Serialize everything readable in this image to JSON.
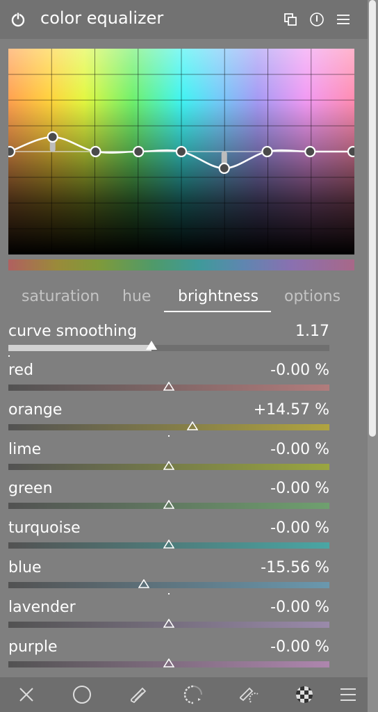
{
  "module": {
    "title": "color equalizer",
    "header_icons": [
      "power-icon",
      "presets-icon",
      "info-icon",
      "menu-icon"
    ]
  },
  "graph": {
    "hue_nodes": 9,
    "curve_values": [
      0.0,
      0.14,
      0.0,
      0.0,
      0.0,
      -0.16,
      0.0,
      0.0,
      0.0
    ],
    "colors": {
      "background_top": [
        "#ffa04f",
        "#ffd23c",
        "#e3f740",
        "#6ff06c",
        "#3ff4f2",
        "#6fcdf8",
        "#a49af4",
        "#f19af3",
        "#ff8cb0"
      ],
      "curve": "#ffffff",
      "node_fill": "#4a4a4a"
    }
  },
  "tabs": [
    {
      "label": "saturation",
      "active": false
    },
    {
      "label": "hue",
      "active": false
    },
    {
      "label": "brightness",
      "active": true
    },
    {
      "label": "options",
      "active": false
    }
  ],
  "curve_smoothing": {
    "label": "curve smoothing",
    "value": "1.17",
    "fill_fraction": 0.446
  },
  "sliders": [
    {
      "label": "red",
      "value": "-0.00 %",
      "position": 0.5,
      "colors": [
        "#525252",
        "#b17c7c"
      ]
    },
    {
      "label": "orange",
      "value": "+14.57 %",
      "position": 0.573,
      "colors": [
        "#525252",
        "#b0a440"
      ]
    },
    {
      "label": "lime",
      "value": "-0.00 %",
      "position": 0.5,
      "colors": [
        "#525252",
        "#9aa640"
      ]
    },
    {
      "label": "green",
      "value": "-0.00 %",
      "position": 0.5,
      "colors": [
        "#525252",
        "#6fa06f"
      ]
    },
    {
      "label": "turquoise",
      "value": "-0.00 %",
      "position": 0.5,
      "colors": [
        "#525252",
        "#4aa6a4"
      ]
    },
    {
      "label": "blue",
      "value": "-15.56 %",
      "position": 0.422,
      "colors": [
        "#525252",
        "#6a98ae"
      ]
    },
    {
      "label": "lavender",
      "value": "-0.00 %",
      "position": 0.5,
      "colors": [
        "#525252",
        "#9a8aaa"
      ]
    },
    {
      "label": "purple",
      "value": "-0.00 %",
      "position": 0.5,
      "colors": [
        "#525252",
        "#ae86ae"
      ]
    }
  ],
  "bottom_toolbar": [
    "close-icon",
    "circle-icon",
    "pencil-icon",
    "drawn-mask-icon",
    "parametric-mask-icon",
    "raster-mask-icon",
    "menu-icon"
  ]
}
